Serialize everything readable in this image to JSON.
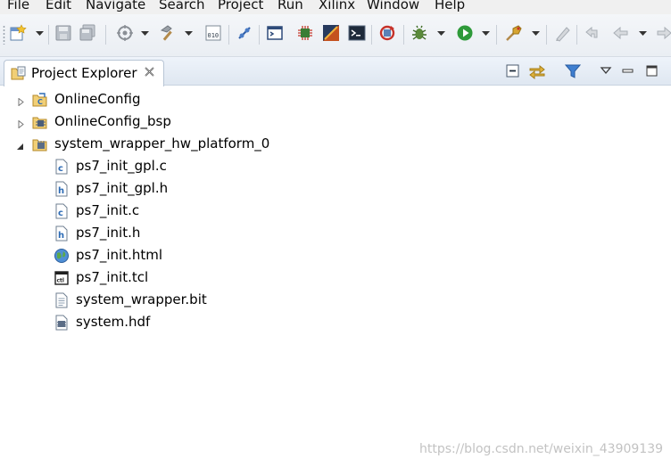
{
  "menu": [
    "File",
    "Edit",
    "Navigate",
    "Search",
    "Project",
    "Run",
    "Xilinx",
    "Window",
    "Help"
  ],
  "toolbar": {
    "icons": [
      "new-icon",
      "save-icon",
      "save-all-icon",
      "build-target-icon",
      "build-icon",
      "binary-icon",
      "debug-connect-icon",
      "console-icon",
      "program-icon",
      "vivado-icon",
      "terminal-icon",
      "refresh-icon",
      "debug-icon",
      "run-icon",
      "external-tools-icon",
      "marker-icon",
      "back-icon",
      "forward-icon"
    ]
  },
  "view": {
    "tab_label": "Project Explorer",
    "tab_icon": "project-explorer-icon",
    "view_icons": [
      "collapse-all-icon",
      "link-with-editor-icon",
      "filter-icon",
      "view-menu-icon",
      "minimize-icon",
      "maximize-icon"
    ]
  },
  "tree": {
    "items": [
      {
        "label": "OnlineConfig",
        "icon": "c-project-folder-icon",
        "level": 0,
        "expanded": false
      },
      {
        "label": "OnlineConfig_bsp",
        "icon": "bsp-project-icon",
        "level": 0,
        "expanded": false
      },
      {
        "label": "system_wrapper_hw_platform_0",
        "icon": "hw-platform-icon",
        "level": 0,
        "expanded": true
      },
      {
        "label": "ps7_init_gpl.c",
        "icon": "c-file-icon",
        "level": 1
      },
      {
        "label": "ps7_init_gpl.h",
        "icon": "h-file-icon",
        "level": 1
      },
      {
        "label": "ps7_init.c",
        "icon": "c-file-icon",
        "level": 1
      },
      {
        "label": "ps7_init.h",
        "icon": "h-file-icon",
        "level": 1
      },
      {
        "label": "ps7_init.html",
        "icon": "html-file-icon",
        "level": 1
      },
      {
        "label": "ps7_init.tcl",
        "icon": "tcl-file-icon",
        "level": 1
      },
      {
        "label": "system_wrapper.bit",
        "icon": "text-file-icon",
        "level": 1
      },
      {
        "label": "system.hdf",
        "icon": "hdf-file-icon",
        "level": 1
      }
    ]
  },
  "watermark": "https://blog.csdn.net/weixin_43909139",
  "colors": {
    "tab_bar_top": "#eef3fa",
    "tab_bar_bottom": "#dfe7f1",
    "folder_icon": "#e7b955",
    "c_icon": "#2d6bb5"
  }
}
